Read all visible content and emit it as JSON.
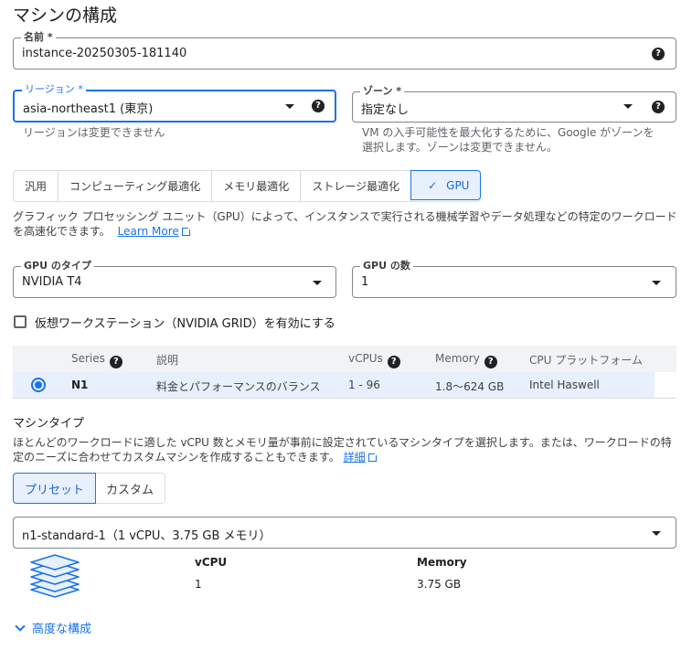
{
  "page": {
    "title": "マシンの構成"
  },
  "name_field": {
    "label": "名前 *",
    "value": "instance-20250305-181140"
  },
  "region_field": {
    "label": "リージョン *",
    "value": "asia-northeast1 (東京)",
    "hint": "リージョンは変更できません"
  },
  "zone_field": {
    "label": "ゾーン *",
    "value": "指定なし",
    "hint_line1": "VM の入手可能性を最大化するために、Google がゾーンを",
    "hint_line2": "選択します。ゾーンは変更できません。"
  },
  "tabs": [
    {
      "label": "汎用"
    },
    {
      "label": "コンピューティング最適化"
    },
    {
      "label": "メモリ最適化"
    },
    {
      "label": "ストレージ最適化"
    },
    {
      "label": "GPU"
    }
  ],
  "gpu_desc": {
    "line1": "グラフィック プロセッシング ユニット（GPU）によって、インスタンスで実行される機械学習やデータ処理などの特定のワークロード",
    "line2": "を高速化できます。",
    "link": "Learn More"
  },
  "gpu_type": {
    "label": "GPU のタイプ",
    "value": "NVIDIA T4"
  },
  "gpu_count": {
    "label": "GPU の数",
    "value": "1"
  },
  "virtual_ws": {
    "label": "仮想ワークステーション（NVIDIA GRID）を有効にする"
  },
  "series_table": {
    "headers": {
      "series": "Series",
      "desc": "説明",
      "vcpus": "vCPUs",
      "memory": "Memory",
      "platform": "CPU プラットフォーム"
    },
    "row": {
      "series": "N1",
      "desc": "料金とパフォーマンスのバランス",
      "vcpus": "1 - 96",
      "memory": "1.8〜624 GB",
      "platform": "Intel Haswell"
    }
  },
  "machine_type": {
    "title": "マシンタイプ",
    "desc_line1": "ほとんどのワークロードに適した vCPU 数とメモリ量が事前に設定されているマシンタイプを選択します。または、ワークロードの特",
    "desc_line2": "定のニーズに合わせてカスタムマシンを作成することもできます。",
    "link": "詳細",
    "preset": "プリセット",
    "custom": "カスタム",
    "selected": "n1-standard-1（1 vCPU、3.75 GB メモリ）",
    "vcpu_label": "vCPU",
    "vcpu_value": "1",
    "memory_label": "Memory",
    "memory_value": "3.75 GB"
  },
  "advanced": {
    "label": "高度な構成"
  },
  "help_glyph": "?",
  "check_glyph": "✓"
}
